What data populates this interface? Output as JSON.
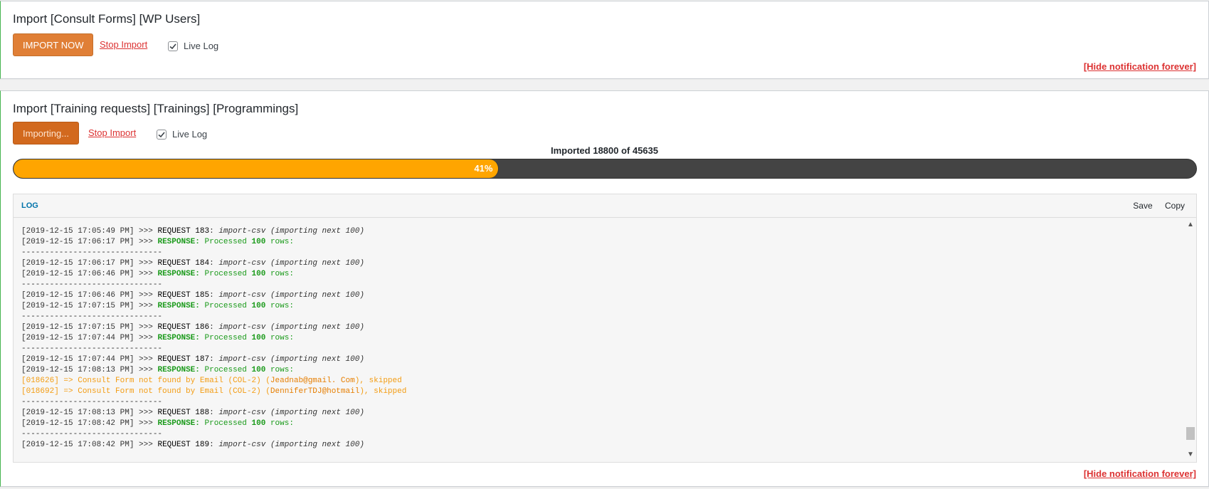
{
  "notice1": {
    "title": "Import [Consult Forms] [WP Users]",
    "import_button": "IMPORT NOW",
    "stop_link": "Stop Import",
    "live_log_label": "Live Log",
    "live_log_checked": true,
    "hide_link": "[Hide notification forever]"
  },
  "notice2": {
    "title": "Import [Training requests] [Trainings] [Programmings]",
    "import_button": "Importing...",
    "stop_link": "Stop Import",
    "live_log_label": "Live Log",
    "live_log_checked": true,
    "progress_label": "Imported 18800 of 45635",
    "progress_value": 0.41,
    "progress_text": "41%",
    "hide_link": "[Hide notification forever]"
  },
  "log": {
    "title": "LOG",
    "save_label": "Save",
    "copy_label": "Copy",
    "lines": [
      {
        "type": "request",
        "ts": "[2019-12-15 17:05:49 PM]",
        "num": "183"
      },
      {
        "type": "response",
        "ts": "[2019-12-15 17:06:17 PM]"
      },
      {
        "type": "sep"
      },
      {
        "type": "request",
        "ts": "[2019-12-15 17:06:17 PM]",
        "num": "184"
      },
      {
        "type": "response",
        "ts": "[2019-12-15 17:06:46 PM]"
      },
      {
        "type": "sep"
      },
      {
        "type": "request",
        "ts": "[2019-12-15 17:06:46 PM]",
        "num": "185"
      },
      {
        "type": "response",
        "ts": "[2019-12-15 17:07:15 PM]"
      },
      {
        "type": "sep"
      },
      {
        "type": "request",
        "ts": "[2019-12-15 17:07:15 PM]",
        "num": "186"
      },
      {
        "type": "response",
        "ts": "[2019-12-15 17:07:44 PM]"
      },
      {
        "type": "sep"
      },
      {
        "type": "request",
        "ts": "[2019-12-15 17:07:44 PM]",
        "num": "187"
      },
      {
        "type": "response",
        "ts": "[2019-12-15 17:08:13 PM]"
      },
      {
        "type": "warn",
        "id": "[018626]",
        "email": "Jeadnab@gmail. Com"
      },
      {
        "type": "warn",
        "id": "[018692]",
        "email": "DenniferTDJ@hotmail"
      },
      {
        "type": "sep"
      },
      {
        "type": "request",
        "ts": "[2019-12-15 17:08:13 PM]",
        "num": "188"
      },
      {
        "type": "response",
        "ts": "[2019-12-15 17:08:42 PM]"
      },
      {
        "type": "sep"
      },
      {
        "type": "request",
        "ts": "[2019-12-15 17:08:42 PM]",
        "num": "189"
      }
    ],
    "text": {
      "arrow": ">>>",
      "request_kw": "REQUEST",
      "request_cmd": "import-csv",
      "request_note": "(importing next 100)",
      "response_kw": "RESPONSE:",
      "response_pre": "Processed",
      "response_num": "100",
      "response_post": "rows:",
      "warn_arrow": "=>",
      "warn_msg": "Consult Form not found by Email (COL-2)",
      "warn_suffix": ", skipped",
      "separator": "------------------------------"
    }
  }
}
